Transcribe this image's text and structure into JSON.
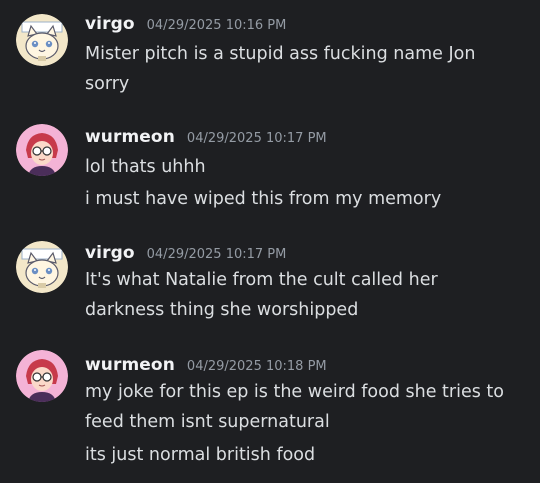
{
  "colors": {
    "background": "#1e1f22",
    "username": "#f2f3f5",
    "timestamp": "#949ba4",
    "message_text": "#dbdee1",
    "wurmeon_avatar_bg": "#f4b3d6",
    "virgo_avatar_bg": "#f3e7c9"
  },
  "messages": [
    {
      "username": "virgo",
      "timestamp": "04/29/2025 10:16 PM",
      "avatar_icon": "cat-avatar-icon",
      "lines": [
        "Mister pitch is a stupid ass fucking name Jon",
        "sorry"
      ]
    },
    {
      "username": "wurmeon",
      "timestamp": "04/29/2025 10:17 PM",
      "avatar_icon": "person-avatar-icon",
      "lines": [
        "lol thats  uhhh",
        "i must have wiped this from my memory"
      ]
    },
    {
      "username": "virgo",
      "timestamp": "04/29/2025 10:17 PM",
      "avatar_icon": "cat-avatar-icon",
      "lines": [
        "It's what Natalie from the cult called her",
        "darkness thing she worshipped"
      ]
    },
    {
      "username": "wurmeon",
      "timestamp": "04/29/2025 10:18 PM",
      "avatar_icon": "person-avatar-icon",
      "lines": [
        "my joke for this ep is the weird food she tries to",
        "feed them isnt supernatural",
        "its just normal british food"
      ]
    }
  ]
}
